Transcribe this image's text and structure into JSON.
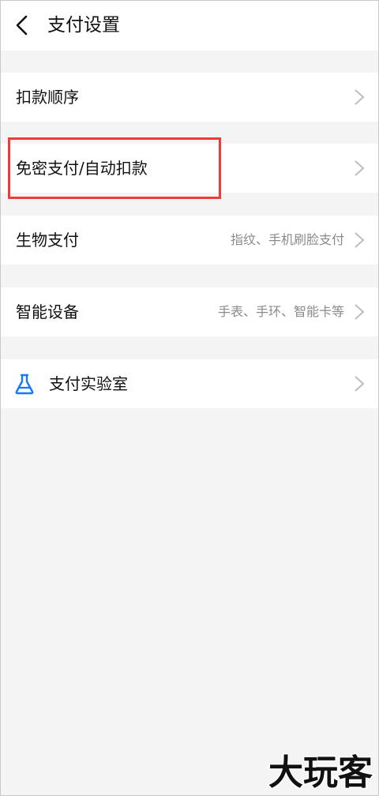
{
  "header": {
    "title": "支付设置"
  },
  "rows": [
    {
      "label": "扣款顺序",
      "value": ""
    },
    {
      "label": "免密支付/自动扣款",
      "value": ""
    },
    {
      "label": "生物支付",
      "value": "指纹、手机刷脸支付"
    },
    {
      "label": "智能设备",
      "value": "手表、手环、智能卡等"
    },
    {
      "label": "支付实验室",
      "value": ""
    }
  ],
  "watermark": {
    "text": "大玩客"
  },
  "colors": {
    "background": "#f4f4f4",
    "card": "#ffffff",
    "highlight": "#f03b3b",
    "icon_blue": "#1677ff"
  }
}
